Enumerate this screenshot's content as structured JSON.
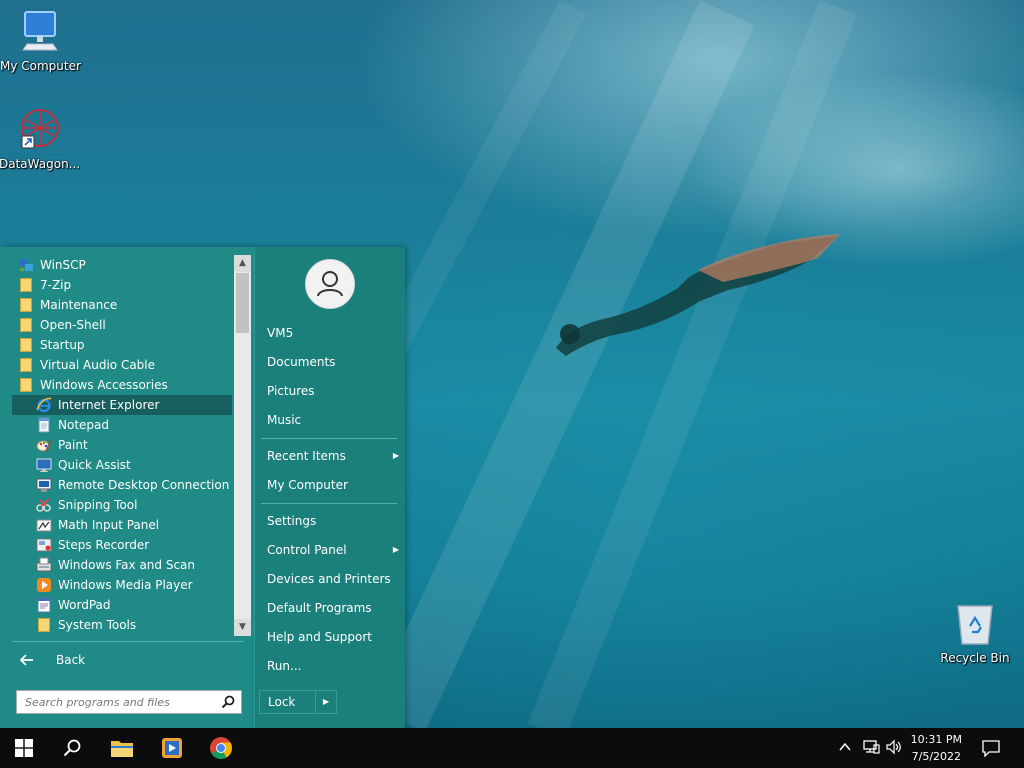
{
  "desktop": {
    "icons": [
      {
        "label": "My Computer"
      },
      {
        "label": "DataWagon..."
      },
      {
        "label": "Recycle Bin"
      }
    ]
  },
  "start_menu": {
    "programs": [
      {
        "label": "WinSCP",
        "icon": "winscp-icon"
      },
      {
        "label": "7-Zip",
        "icon": "folder-icon"
      },
      {
        "label": "Maintenance",
        "icon": "folder-icon"
      },
      {
        "label": "Open-Shell",
        "icon": "folder-icon"
      },
      {
        "label": "Startup",
        "icon": "folder-icon"
      },
      {
        "label": "Virtual Audio Cable",
        "icon": "folder-icon"
      },
      {
        "label": "Windows Accessories",
        "icon": "folder-icon"
      },
      {
        "label": "Internet Explorer",
        "icon": "internet-explorer-icon"
      },
      {
        "label": "Notepad",
        "icon": "notepad-icon"
      },
      {
        "label": "Paint",
        "icon": "paint-icon"
      },
      {
        "label": "Quick Assist",
        "icon": "quick-assist-icon"
      },
      {
        "label": "Remote Desktop Connection",
        "icon": "remote-desktop-icon"
      },
      {
        "label": "Snipping Tool",
        "icon": "snipping-tool-icon"
      },
      {
        "label": "Math Input Panel",
        "icon": "math-input-icon"
      },
      {
        "label": "Steps Recorder",
        "icon": "steps-recorder-icon"
      },
      {
        "label": "Windows Fax and Scan",
        "icon": "fax-scan-icon"
      },
      {
        "label": "Windows Media Player",
        "icon": "media-player-icon"
      },
      {
        "label": "WordPad",
        "icon": "wordpad-icon"
      },
      {
        "label": "System Tools",
        "icon": "folder-icon"
      }
    ],
    "selected_program": "Internet Explorer",
    "back_label": "Back",
    "search_placeholder": "Search programs and files",
    "right_items": {
      "user": "VM5",
      "documents": "Documents",
      "pictures": "Pictures",
      "music": "Music",
      "recent_items": "Recent Items",
      "my_computer": "My Computer",
      "settings": "Settings",
      "control_panel": "Control Panel",
      "devices_printers": "Devices and Printers",
      "default_programs": "Default Programs",
      "help_support": "Help and Support",
      "run": "Run..."
    },
    "lock_label": "Lock"
  },
  "taskbar": {
    "time": "10:31 PM",
    "date": "7/5/2022",
    "accent": "#0c0c0c"
  }
}
